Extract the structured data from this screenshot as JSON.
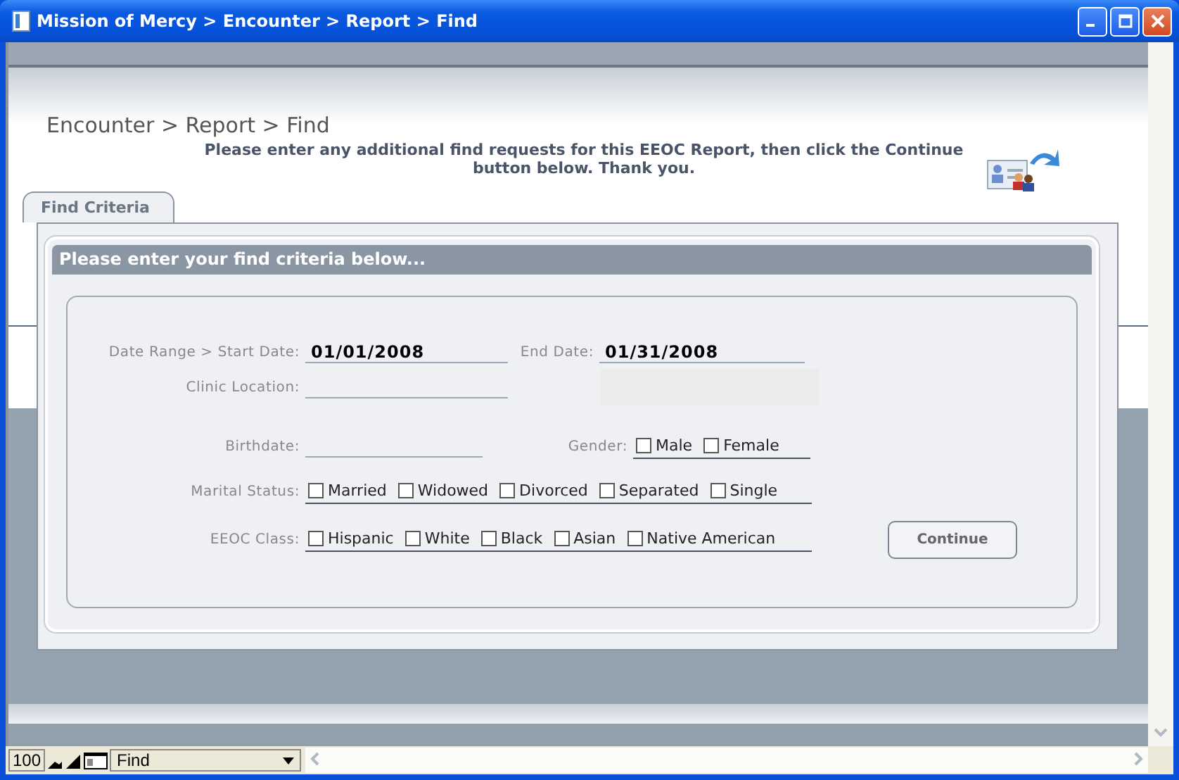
{
  "window": {
    "title": "Mission of Mercy > Encounter > Report > Find"
  },
  "breadcrumb": "Encounter > Report > Find",
  "instructions": "Please enter any additional find requests for this EEOC Report, then click the Continue button below. Thank you.",
  "tabs": [
    {
      "label": "Find Criteria",
      "selected": true
    }
  ],
  "panel_header": "Please enter your find criteria below...",
  "form": {
    "start_date": {
      "label": "Date Range > Start Date:",
      "value": "01/01/2008"
    },
    "end_date": {
      "label": "End Date:",
      "value": "01/31/2008"
    },
    "clinic_location": {
      "label": "Clinic Location:"
    },
    "birthdate": {
      "label": "Birthdate:"
    },
    "gender": {
      "label": "Gender:",
      "options": [
        {
          "label": "Male",
          "checked": false
        },
        {
          "label": "Female",
          "checked": false
        }
      ]
    },
    "marital_status": {
      "label": "Marital Status:",
      "options": [
        {
          "label": "Married",
          "checked": false
        },
        {
          "label": "Widowed",
          "checked": false
        },
        {
          "label": "Divorced",
          "checked": false
        },
        {
          "label": "Separated",
          "checked": false
        },
        {
          "label": "Single",
          "checked": false
        }
      ]
    },
    "eeoc_class": {
      "label": "EEOC Class:",
      "options": [
        {
          "label": "Hispanic",
          "checked": false
        },
        {
          "label": "White",
          "checked": false
        },
        {
          "label": "Black",
          "checked": false
        },
        {
          "label": "Asian",
          "checked": false
        },
        {
          "label": "Native American",
          "checked": false
        }
      ]
    }
  },
  "continue_button": "Continue",
  "status_bar": {
    "zoom": "100",
    "mode": "Find"
  }
}
